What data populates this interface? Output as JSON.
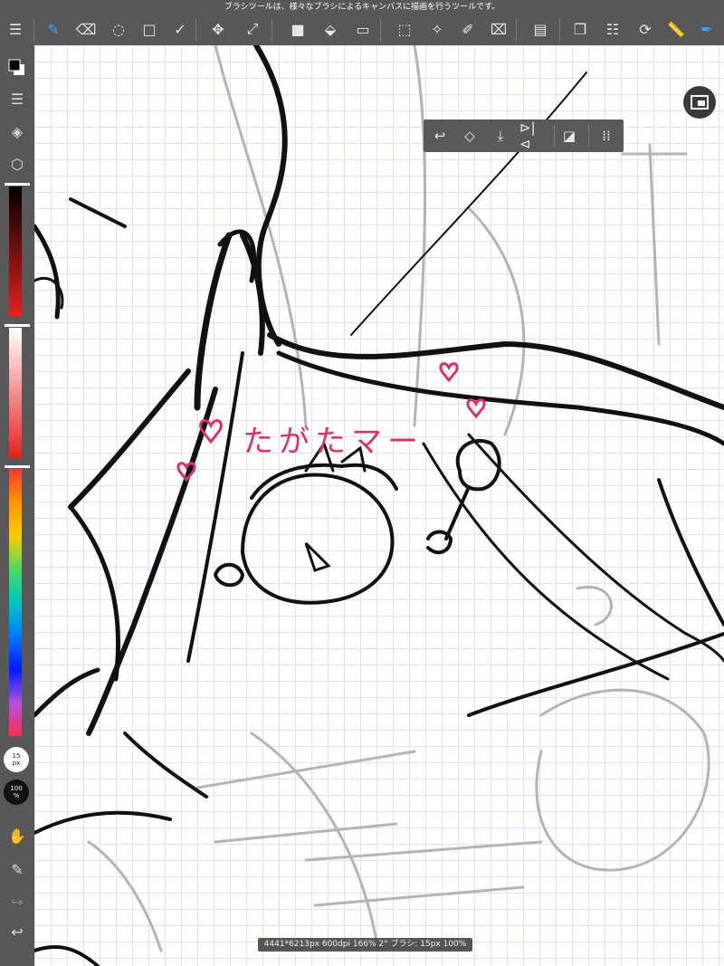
{
  "top_hint": "ブラシツールは、様々なブラシによるキャンバスに描画を行うツールです。",
  "toolbar": {
    "menu_icon": "☰",
    "tools": [
      {
        "name": "brush-tool-icon",
        "glyph": "✎",
        "active": true
      },
      {
        "name": "eraser-tool-icon",
        "glyph": "⌫",
        "active": false
      },
      {
        "name": "blur-tool-icon",
        "glyph": "◌",
        "active": false
      },
      {
        "name": "shape-tool-icon",
        "glyph": "□",
        "active": false
      },
      {
        "name": "correction-tool-icon",
        "glyph": "✓",
        "active": false
      },
      {
        "name": "move-tool-icon",
        "glyph": "✥",
        "active": false
      },
      {
        "name": "transform-tool-icon",
        "glyph": "⤢",
        "active": false
      },
      {
        "name": "fill-color-icon",
        "glyph": "■",
        "active": false
      },
      {
        "name": "bucket-tool-icon",
        "glyph": "⬙",
        "active": false
      },
      {
        "name": "gradient-tool-icon",
        "glyph": "▭",
        "active": false
      },
      {
        "name": "select-rect-icon",
        "glyph": "⬚",
        "active": false
      },
      {
        "name": "magic-wand-icon",
        "glyph": "✧",
        "active": false
      },
      {
        "name": "select-pen-icon",
        "glyph": "✐",
        "active": false
      },
      {
        "name": "select-eraser-icon",
        "glyph": "⌧",
        "active": false
      },
      {
        "name": "layout-icon",
        "glyph": "▤",
        "active": false
      },
      {
        "name": "layer-copy-icon",
        "glyph": "❐",
        "active": false
      },
      {
        "name": "selection-list-icon",
        "glyph": "☷",
        "active": false
      },
      {
        "name": "rotate-icon",
        "glyph": "⟳",
        "active": false
      },
      {
        "name": "ruler-icon",
        "glyph": "📏",
        "active": false
      },
      {
        "name": "pen-settings-icon",
        "glyph": "✒",
        "active": true
      }
    ]
  },
  "sidebar": {
    "brush_size_value": "15",
    "brush_size_unit": "px",
    "opacity_value": "100",
    "opacity_unit": "%"
  },
  "colors": {
    "accent": "#3fa6ff",
    "sketch_lines": "#111111",
    "pink_text": "#d6336c",
    "grid": "#dfe3ef"
  },
  "canvas_text": "たがたマー",
  "float_toolbar": {
    "icons": [
      "undo-icon",
      "clear-icon",
      "download-icon",
      "flip-icon",
      "edit-icon",
      "grip-icon"
    ]
  },
  "status_bar": "4441*6213px 600dpi 166% 2° ブラシ: 15px 100%"
}
